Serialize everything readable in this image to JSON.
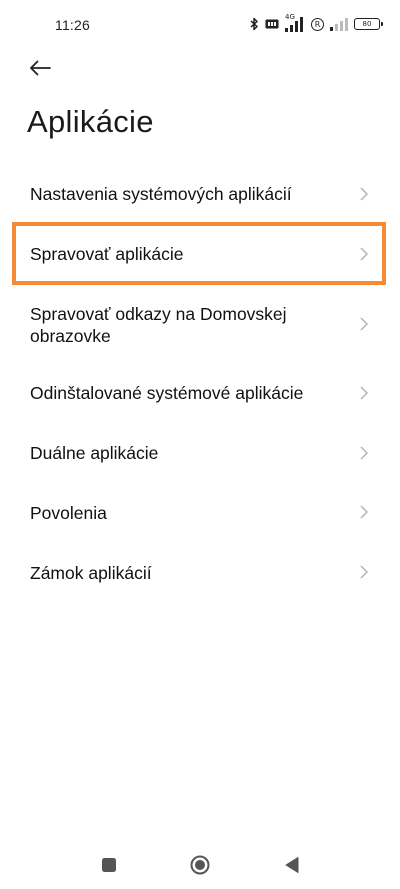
{
  "status_bar": {
    "time": "11:26",
    "network_label": "4G",
    "roaming_label": "R",
    "battery_level": "80"
  },
  "header": {
    "title": "Aplikácie"
  },
  "menu": {
    "items": [
      {
        "label": "Nastavenia systémových aplikácií"
      },
      {
        "label": "Spravovať aplikácie"
      },
      {
        "label": "Spravovať odkazy na Domovskej obrazovke"
      },
      {
        "label": "Odinštalované systémové aplikácie"
      },
      {
        "label": "Duálne aplikácie"
      },
      {
        "label": "Povolenia"
      },
      {
        "label": "Zámok aplikácií"
      }
    ]
  },
  "icons": {
    "back": "arrow-left-icon",
    "chevron": "chevron-right-icon",
    "nav_recents": "square-icon",
    "nav_home": "circle-icon",
    "nav_back": "triangle-back-icon"
  },
  "colors": {
    "highlight": "#f58a37",
    "text": "#111111",
    "chevron": "#b5b5b5"
  }
}
